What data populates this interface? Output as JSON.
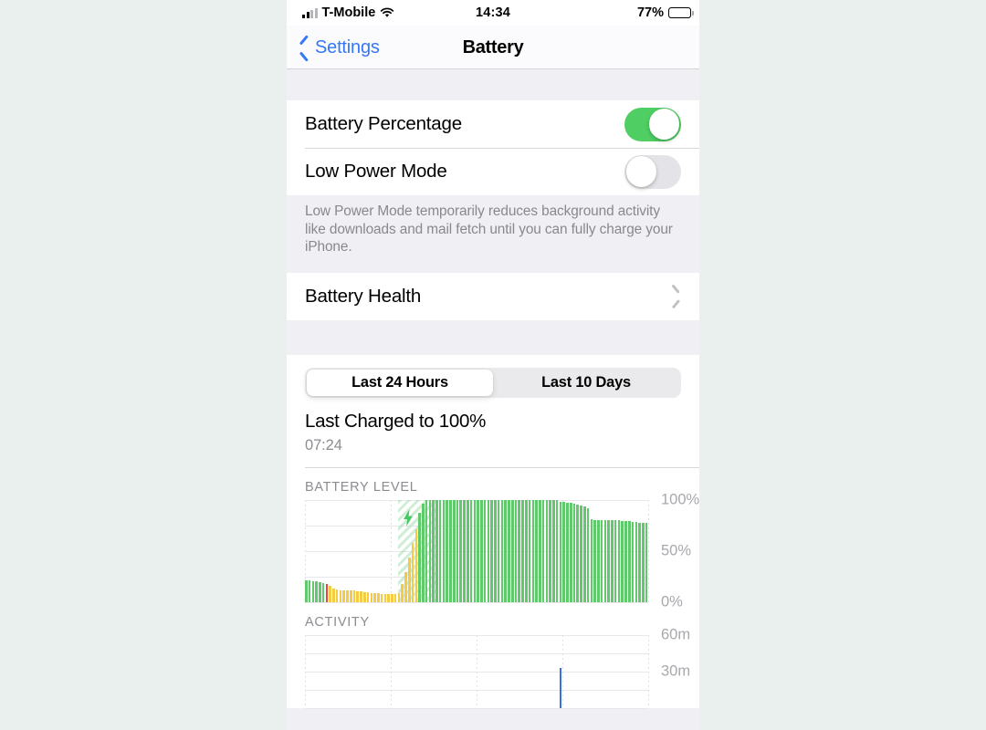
{
  "status_bar": {
    "carrier": "T-Mobile",
    "time": "14:34",
    "battery_percent_label": "77%",
    "battery_level": 77,
    "signal_icon": "cellular-signal-icon",
    "wifi_icon": "wifi-icon",
    "battery_icon": "battery-icon"
  },
  "nav": {
    "back_label": "Settings",
    "back_icon": "chevron-left-icon",
    "title": "Battery"
  },
  "settings_group": {
    "rows": [
      {
        "label": "Battery Percentage",
        "toggle": "on"
      },
      {
        "label": "Low Power Mode",
        "toggle": "off"
      }
    ],
    "footnote": "Low Power Mode temporarily reduces background activity like downloads and mail fetch until you can fully charge your iPhone."
  },
  "health_group": {
    "label": "Battery Health",
    "disclosure_icon": "chevron-right-icon"
  },
  "usage_card": {
    "segments": [
      {
        "label": "Last 24 Hours",
        "selected": true
      },
      {
        "label": "Last 10 Days",
        "selected": false
      }
    ],
    "last_charged_title": "Last Charged to 100%",
    "last_charged_time": "07:24"
  },
  "colors": {
    "accent_blue": "#3478f6",
    "toggle_on_green": "#4fce63",
    "bar_green": "#5fc96b",
    "bar_yellow": "#f3cb45",
    "bar_red": "#e8453c",
    "bar_blue": "#3a6fe0",
    "page_background": "#e9f0ee",
    "group_background": "#efeff4"
  },
  "chart_data": [
    {
      "type": "bar",
      "title": "BATTERY LEVEL",
      "xlabel": "",
      "ylabel": "",
      "ylim": [
        0,
        100
      ],
      "ytick_labels": [
        "100%",
        "50%",
        "0%"
      ],
      "ytick_values": [
        100,
        50,
        0
      ],
      "grid": true,
      "legend": "none",
      "annotations": [
        {
          "icon": "lightning-bolt-icon",
          "label": "charging",
          "x_index": 27
        }
      ],
      "charging_band": {
        "start_index": 27,
        "end_index": 38
      },
      "bar_colors": {
        "green": "#5fc96b",
        "yellow": "#f3cb45",
        "red": "#e8453c"
      },
      "values": [
        22,
        22,
        21,
        21,
        20,
        19,
        18,
        16,
        14,
        13,
        12,
        12,
        12,
        12,
        12,
        11,
        11,
        10,
        10,
        9,
        9,
        9,
        8,
        8,
        8,
        8,
        8,
        9,
        18,
        30,
        44,
        58,
        72,
        88,
        97,
        100,
        100,
        100,
        100,
        100,
        100,
        100,
        100,
        100,
        100,
        100,
        100,
        100,
        100,
        100,
        100,
        100,
        100,
        100,
        100,
        100,
        100,
        100,
        100,
        100,
        100,
        100,
        100,
        100,
        100,
        100,
        100,
        100,
        100,
        100,
        100,
        100,
        100,
        100,
        99,
        99,
        98,
        98,
        97,
        96,
        95,
        94,
        92,
        82,
        81,
        81,
        81,
        81,
        81,
        81,
        81,
        81,
        80,
        80,
        80,
        79,
        79,
        78,
        78,
        78
      ],
      "colors_by_index": [
        "green",
        "green",
        "green",
        "green",
        "green",
        "green",
        "red",
        "yellow",
        "yellow",
        "yellow",
        "yellow",
        "yellow",
        "yellow",
        "yellow",
        "yellow",
        "yellow",
        "yellow",
        "yellow",
        "yellow",
        "yellow",
        "yellow",
        "yellow",
        "yellow",
        "yellow",
        "yellow",
        "yellow",
        "yellow",
        "yellow",
        "yellow",
        "yellow",
        "yellow",
        "yellow",
        "yellow",
        "green",
        "green",
        "green",
        "green",
        "green",
        "green",
        "green",
        "green",
        "green",
        "green",
        "green",
        "green",
        "green",
        "green",
        "green",
        "green",
        "green",
        "green",
        "green",
        "green",
        "green",
        "green",
        "green",
        "green",
        "green",
        "green",
        "green",
        "green",
        "green",
        "green",
        "green",
        "green",
        "green",
        "green",
        "green",
        "green",
        "green",
        "green",
        "green",
        "green",
        "green",
        "green",
        "green",
        "green",
        "green",
        "green",
        "green",
        "green",
        "green",
        "green",
        "green",
        "green",
        "green",
        "green",
        "green",
        "green",
        "green",
        "green",
        "green",
        "green",
        "green",
        "green",
        "green",
        "green",
        "green",
        "green",
        "green"
      ]
    },
    {
      "type": "bar",
      "title": "ACTIVITY",
      "xlabel": "",
      "ylabel": "",
      "ylim": [
        0,
        60
      ],
      "ytick_labels": [
        "60m",
        "30m"
      ],
      "ytick_values": [
        60,
        30
      ],
      "grid": true,
      "legend": "none",
      "bar_color": "#3a6fe0",
      "values": [
        0,
        0,
        0,
        0,
        0,
        0,
        0,
        0,
        0,
        0,
        0,
        0,
        0,
        0,
        0,
        0,
        0,
        0,
        0,
        0,
        0,
        0,
        0,
        0,
        0,
        0,
        0,
        0,
        0,
        0,
        0,
        0,
        0,
        0,
        0,
        0,
        0,
        0,
        0,
        0,
        0,
        0,
        0,
        0,
        0,
        0,
        0,
        0,
        0,
        0,
        0,
        0,
        0,
        0,
        0,
        0,
        0,
        0,
        0,
        0,
        0,
        0,
        0,
        0,
        0,
        0,
        0,
        0,
        0,
        0,
        0,
        0,
        0,
        0,
        33,
        0,
        0,
        0,
        0,
        0,
        0,
        0,
        0,
        0,
        0,
        0,
        0,
        0,
        0,
        0,
        0,
        0,
        0,
        0,
        0,
        0,
        0,
        0,
        0,
        0
      ]
    }
  ]
}
